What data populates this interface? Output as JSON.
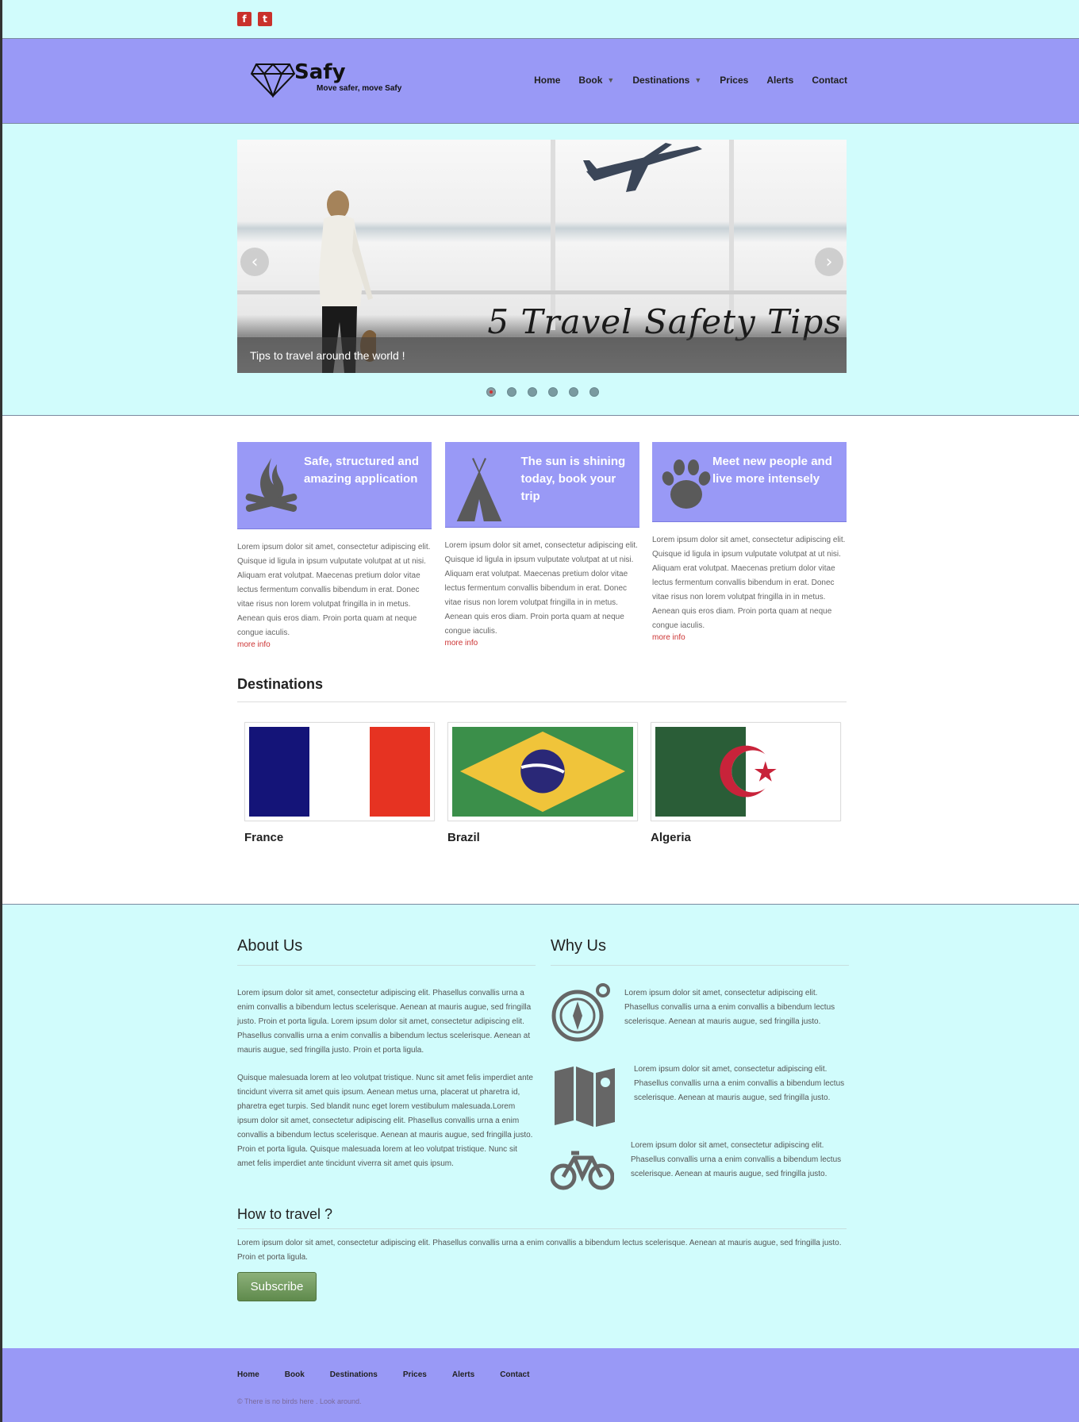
{
  "social": {
    "facebook": "f",
    "twitter": "t"
  },
  "logo": {
    "name": "Safy",
    "tagline": "Move safer, move Safy"
  },
  "nav": [
    {
      "label": "Home",
      "caret": false
    },
    {
      "label": "Book",
      "caret": true
    },
    {
      "label": "Destinations",
      "caret": true
    },
    {
      "label": "Prices",
      "caret": false
    },
    {
      "label": "Alerts",
      "caret": false
    },
    {
      "label": "Contact",
      "caret": false
    }
  ],
  "hero": {
    "title": "5 Travel Safety Tips",
    "caption": "Tips to travel around the world !",
    "prev": "‹",
    "next": "›",
    "dot_count": 6,
    "active_dot": 0
  },
  "features": [
    {
      "icon": "campfire-icon",
      "title": "Safe, structured and amazing application",
      "text": "Lorem ipsum dolor sit amet, consectetur adipiscing elit. Quisque id ligula in ipsum vulputate volutpat at ut nisi. Aliquam erat volutpat. Maecenas pretium dolor vitae lectus fermentum convallis bibendum in erat. Donec vitae risus non lorem volutpat fringilla in in metus. Aenean quis eros diam. Proin porta quam at neque congue iaculis.",
      "more": "more info"
    },
    {
      "icon": "tent-icon",
      "title": "The sun is shining today, book your trip",
      "text": "Lorem ipsum dolor sit amet, consectetur adipiscing elit. Quisque id ligula in ipsum vulputate volutpat at ut nisi. Aliquam erat volutpat. Maecenas pretium dolor vitae lectus fermentum convallis bibendum in erat. Donec vitae risus non lorem volutpat fringilla in in metus. Aenean quis eros diam. Proin porta quam at neque congue iaculis.",
      "more": "more info"
    },
    {
      "icon": "paw-icon",
      "title": "Meet new people and live more intensely",
      "text": "Lorem ipsum dolor sit amet, consectetur adipiscing elit. Quisque id ligula in ipsum vulputate volutpat at ut nisi. Aliquam erat volutpat. Maecenas pretium dolor vitae lectus fermentum convallis bibendum in erat. Donec vitae risus non lorem volutpat fringilla in in metus. Aenean quis eros diam. Proin porta quam at neque congue iaculis.",
      "more": "more info"
    }
  ],
  "destinations": {
    "title": "Destinations",
    "items": [
      {
        "name": "France",
        "flag": "france-flag"
      },
      {
        "name": "Brazil",
        "flag": "brazil-flag"
      },
      {
        "name": "Algeria",
        "flag": "algeria-flag"
      }
    ]
  },
  "about": {
    "title": "About Us",
    "p1": "Lorem ipsum dolor sit amet, consectetur adipiscing elit. Phasellus convallis urna a enim convallis a bibendum lectus scelerisque. Aenean at mauris augue, sed fringilla justo. Proin et porta ligula. Lorem ipsum dolor sit amet, consectetur adipiscing elit. Phasellus convallis urna a enim convallis a bibendum lectus scelerisque. Aenean at mauris augue, sed fringilla justo. Proin et porta ligula.",
    "p2": "Quisque malesuada lorem at leo volutpat tristique. Nunc sit amet felis imperdiet ante tincidunt viverra sit amet quis ipsum. Aenean metus urna, placerat ut pharetra id, pharetra eget turpis. Sed blandit nunc eget lorem vestibulum malesuada.Lorem ipsum dolor sit amet, consectetur adipiscing elit. Phasellus convallis urna a enim convallis a bibendum lectus scelerisque. Aenean at mauris augue, sed fringilla justo. Proin et porta ligula. Quisque malesuada lorem at leo volutpat tristique. Nunc sit amet felis imperdiet ante tincidunt viverra sit amet quis ipsum."
  },
  "why": {
    "title": "Why Us",
    "items": [
      {
        "icon": "compass-icon",
        "text": "Lorem ipsum dolor sit amet, consectetur adipiscing elit. Phasellus convallis urna a enim convallis a bibendum lectus scelerisque. Aenean at mauris augue, sed fringilla justo."
      },
      {
        "icon": "map-icon",
        "text": "Lorem ipsum dolor sit amet, consectetur adipiscing elit. Phasellus convallis urna a enim convallis a bibendum lectus scelerisque. Aenean at mauris augue, sed fringilla justo."
      },
      {
        "icon": "bicycle-icon",
        "text": "Lorem ipsum dolor sit amet, consectetur adipiscing elit. Phasellus convallis urna a enim convallis a bibendum lectus scelerisque. Aenean at mauris augue, sed fringilla justo."
      }
    ]
  },
  "how": {
    "title": "How to travel ?",
    "text": "Lorem ipsum dolor sit amet, consectetur adipiscing elit. Phasellus convallis urna a enim convallis a bibendum lectus scelerisque. Aenean at mauris augue, sed fringilla justo. Proin et porta ligula.",
    "button": "Subscribe"
  },
  "footer": {
    "nav": [
      "Home",
      "Book",
      "Destinations",
      "Prices",
      "Alerts",
      "Contact"
    ],
    "copy": "© There is no birds here . Look around."
  },
  "colors": {
    "header": "#9999f6",
    "section_bg": "#d1fcfc",
    "link_red": "#cc3333",
    "subscribe": "#6f9a5c"
  }
}
